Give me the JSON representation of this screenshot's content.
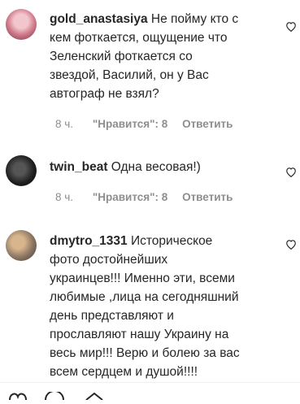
{
  "comments": [
    {
      "username": "gold_anastasiya",
      "text": " Не пойму кто с\nкем фоткается, ощущение что\nЗеленский фоткается со\nзвездой, Василий, он у Вас\nавтограф не взял?",
      "time": "8 ч.",
      "likes": "\"Нравится\": 8",
      "reply": "Ответить",
      "avatar_icon": "user-avatar-icon"
    },
    {
      "username": "twin_beat",
      "text": " Одна весовая!)",
      "time": "8 ч.",
      "likes": "\"Нравится\": 8",
      "reply": "Ответить",
      "avatar_icon": "user-avatar-icon"
    },
    {
      "username": "dmytro_1331",
      "text": " Историческое\nфото достойнейших\nукраинцев!!! Именно эти, всеми\nлюбимые ,лица на сегодняшний\nдень представляют и\nпрославляют нашу Украину на\nвесь мир!!! Верю и болею за вас\nвсем сердцем и душой!!!!",
      "avatar_icon": "user-avatar-icon"
    }
  ],
  "icons": {
    "like": "heart-icon",
    "bottom": [
      "heart-icon",
      "comment-icon",
      "share-icon"
    ]
  },
  "colors": {
    "text": "#262626",
    "meta": "#8e8e8e",
    "border": "#efefef"
  }
}
